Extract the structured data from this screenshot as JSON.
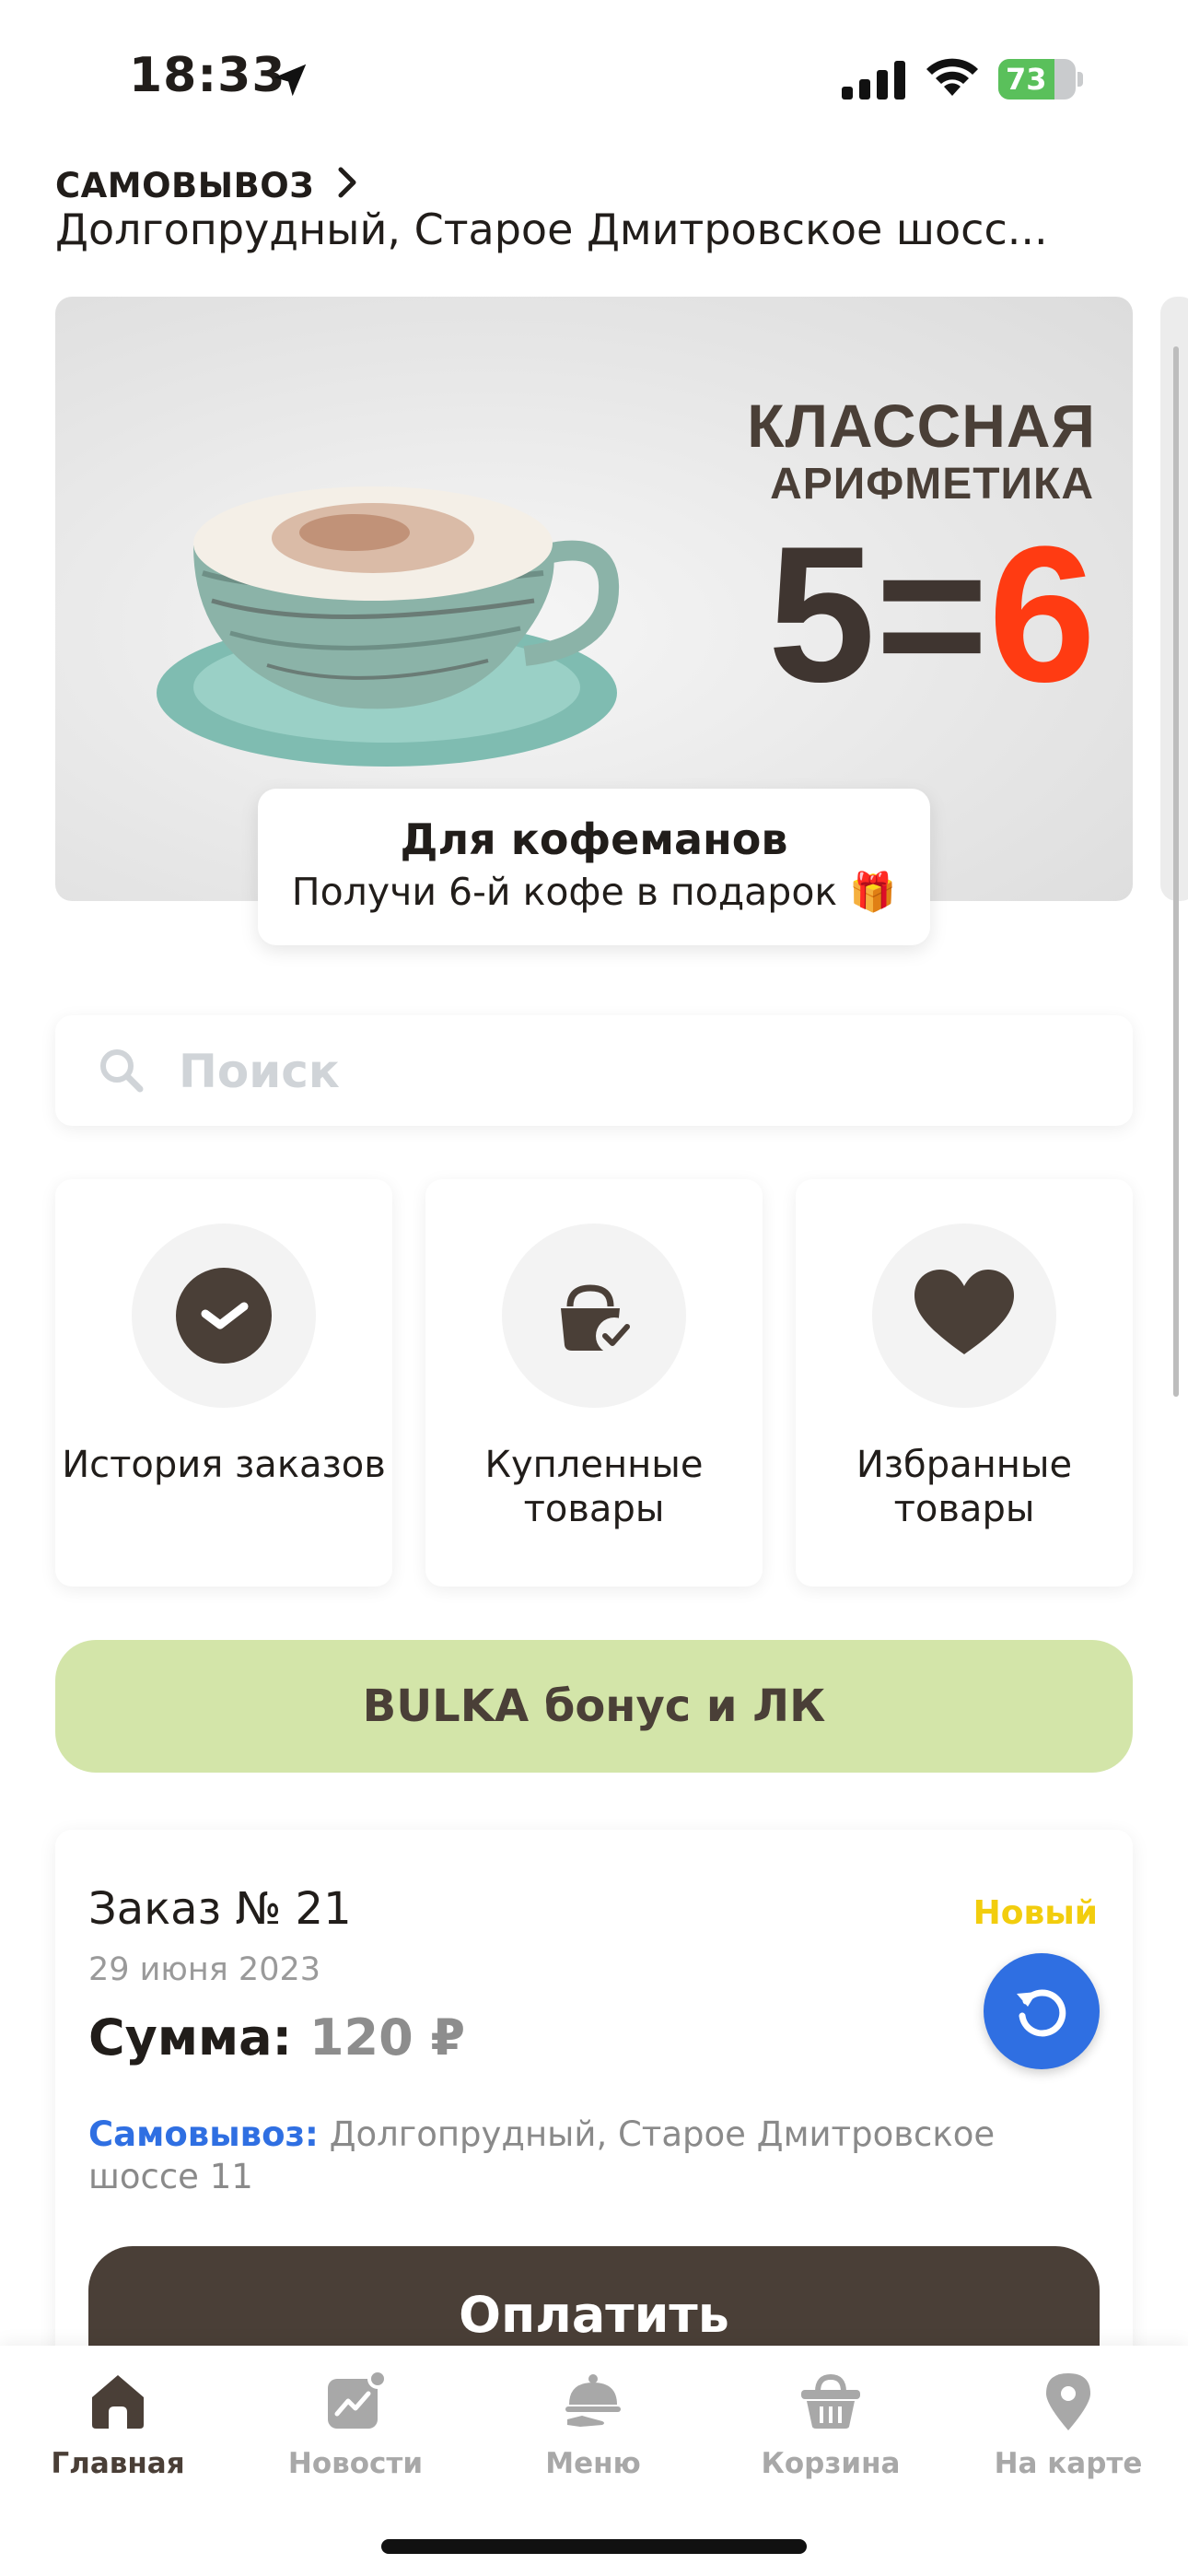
{
  "status_bar": {
    "time": "18:33",
    "battery": "73",
    "battery_level": 0.73
  },
  "header": {
    "mode_label": "САМОВЫВОЗ",
    "address": "Долгопрудный, Старое Дмитровское шосс..."
  },
  "banner": {
    "headline": "КЛАССНАЯ",
    "subheadline": "АРИФМЕТИКА",
    "equation_left": "5=",
    "equation_right": "6",
    "card_title": "Для кофеманов",
    "card_text": "Получи 6-й кофе в подарок 🎁"
  },
  "search": {
    "placeholder": "Поиск",
    "value": ""
  },
  "tiles": [
    {
      "label": "История заказов",
      "icon": "check-circle-icon"
    },
    {
      "label": "Купленные товары",
      "icon": "purchased-bag-icon"
    },
    {
      "label": "Избранные товары",
      "icon": "heart-icon"
    }
  ],
  "bonus_button": {
    "label": "BULKA бонус и ЛК"
  },
  "order": {
    "number": "Заказ № 21",
    "status": "Новый",
    "date": "29 июня 2023",
    "sum_label": "Сумма:",
    "sum_value": "120 ₽",
    "pickup_label": "Самовывоз:",
    "pickup_address": "Долгопрудный, Старое Дмитровское шоссе 11",
    "pay_label": "Оплатить"
  },
  "tabbar": {
    "items": [
      {
        "label": "Главная",
        "icon": "home-icon",
        "active": true
      },
      {
        "label": "Новости",
        "icon": "news-icon",
        "active": false
      },
      {
        "label": "Меню",
        "icon": "menu-cloche-icon",
        "active": false
      },
      {
        "label": "Корзина",
        "icon": "basket-icon",
        "active": false
      },
      {
        "label": "На карте",
        "icon": "map-pin-icon",
        "active": false
      }
    ]
  },
  "colors": {
    "brand_brown": "#4a3f37",
    "bonus_green": "#d3e5a9",
    "accent_blue": "#2f6fe2",
    "status_yellow": "#f2cd0d",
    "promo_red": "#ff3b12"
  }
}
